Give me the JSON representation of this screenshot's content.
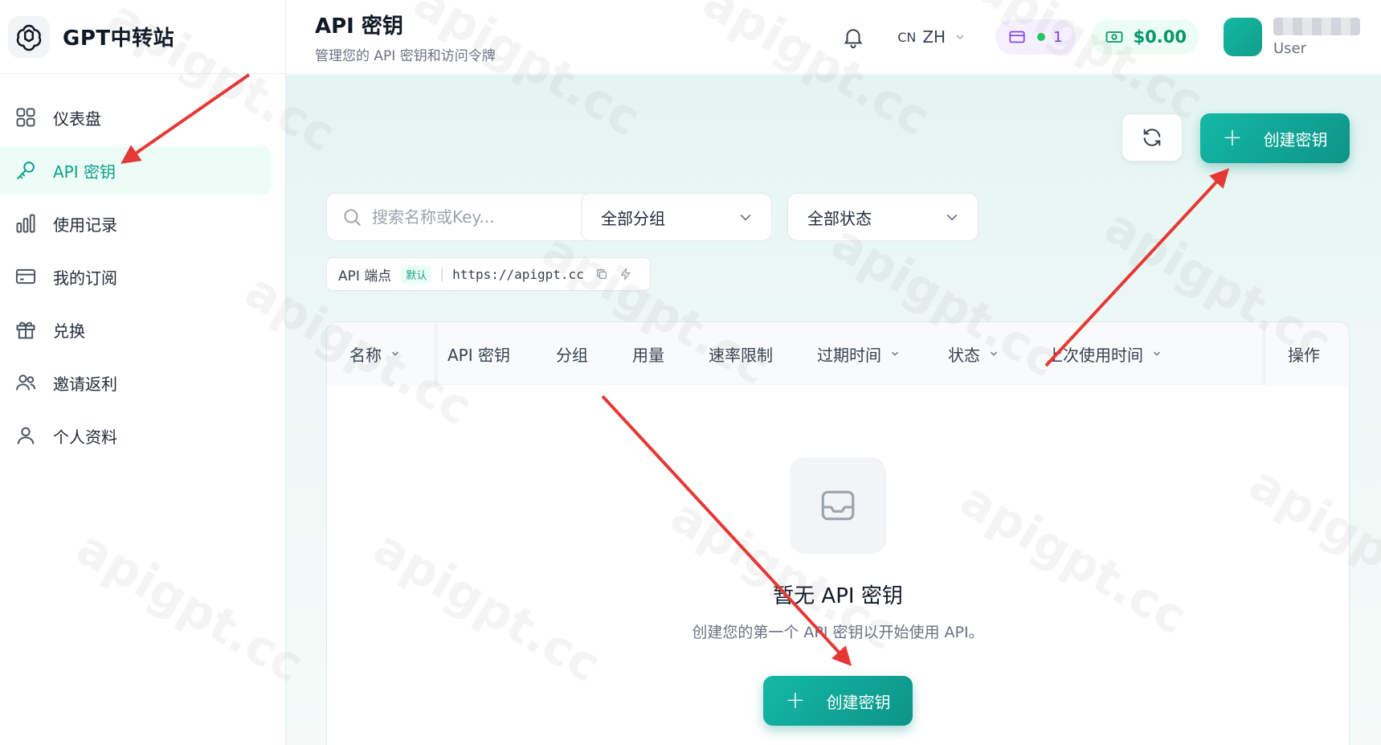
{
  "brand": {
    "name": "GPT中转站"
  },
  "sidebar": {
    "items": [
      {
        "label": "仪表盘",
        "icon": "dashboard-icon",
        "active": false
      },
      {
        "label": "API 密钥",
        "icon": "key-icon",
        "active": true
      },
      {
        "label": "使用记录",
        "icon": "bar-chart-icon",
        "active": false
      },
      {
        "label": "我的订阅",
        "icon": "credit-card-icon",
        "active": false
      },
      {
        "label": "兑换",
        "icon": "gift-icon",
        "active": false
      },
      {
        "label": "邀请返利",
        "icon": "users-icon",
        "active": false
      },
      {
        "label": "个人资料",
        "icon": "user-icon",
        "active": false
      }
    ]
  },
  "header": {
    "title": "API 密钥",
    "subtitle": "管理您的 API 密钥和访问令牌",
    "lang_code": "CN",
    "lang_label": "ZH",
    "subscription_count": "1",
    "balance": "$0.00",
    "user_role": "User"
  },
  "toolbar": {
    "create_label": "创建密钥",
    "search_placeholder": "搜索名称或Key...",
    "group_filter": "全部分组",
    "status_filter": "全部状态"
  },
  "endpoint": {
    "label": "API 端点",
    "badge": "默认",
    "url": "https://apigpt.cc"
  },
  "table": {
    "columns": [
      "名称",
      "API 密钥",
      "分组",
      "用量",
      "速率限制",
      "过期时间",
      "状态",
      "上次使用时间",
      "操作"
    ]
  },
  "empty_state": {
    "title": "暂无 API 密钥",
    "description": "创建您的第一个 API 密钥以开始使用 API。",
    "button_label": "创建密钥"
  },
  "watermark": "apigpt.cc",
  "colors": {
    "accent": "#0f9f88",
    "arrow": "#e53935"
  }
}
